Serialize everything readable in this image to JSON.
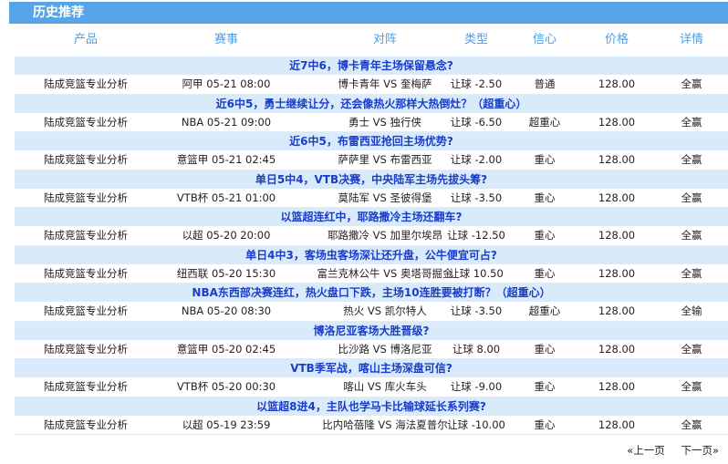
{
  "header": {
    "title": "历史推荐"
  },
  "columns": [
    "产品",
    "赛事",
    "对阵",
    "类型",
    "信心",
    "价格",
    "详情"
  ],
  "rows": [
    {
      "headline": "近7中6，博卡青年主场保留悬念?",
      "product": "陆成竞篮专业分析",
      "match": "阿甲 05-21 08:00",
      "teams": "博卡青年 VS 奎梅萨",
      "type": "让球 -2.50",
      "confidence": "普通",
      "price": "128.00",
      "result": "全赢"
    },
    {
      "headline": "近6中5，勇士继续让分，还会像热火那样大热倒灶？（超重心）",
      "product": "陆成竞篮专业分析",
      "match": "NBA 05-21 09:00",
      "teams": "勇士 VS 独行侠",
      "type": "让球 -6.50",
      "confidence": "超重心",
      "price": "128.00",
      "result": "全赢"
    },
    {
      "headline": "近6中5，布雷西亚抢回主场优势?",
      "product": "陆成竞篮专业分析",
      "match": "意篮甲 05-21 02:45",
      "teams": "萨萨里 VS 布雷西亚",
      "type": "让球 -2.00",
      "confidence": "重心",
      "price": "128.00",
      "result": "全赢"
    },
    {
      "headline": "单日5中4，VTB决赛，中央陆军主场先拔头筹?",
      "product": "陆成竞篮专业分析",
      "match": "VTB杯 05-21 01:00",
      "teams": "莫陆军 VS 圣彼得堡",
      "type": "让球 -3.50",
      "confidence": "重心",
      "price": "128.00",
      "result": "全赢"
    },
    {
      "headline": "以篮超连红中，耶路撒冷主场还翻车?",
      "product": "陆成竞篮专业分析",
      "match": "以超 05-20 20:00",
      "teams": "耶路撒冷 VS 加里尔埃昂",
      "type": "让球 -12.50",
      "confidence": "重心",
      "price": "128.00",
      "result": "全赢"
    },
    {
      "headline": "单日4中3，客场虫客场深让还升盘，公牛便宜可占?",
      "product": "陆成竞篮专业分析",
      "match": "纽西联 05-20 15:30",
      "teams": "富兰克林公牛 VS 奥塔哥掘金",
      "type": "让球 10.50",
      "confidence": "重心",
      "price": "128.00",
      "result": "全赢"
    },
    {
      "headline": "NBA东西部决赛连红，热火盘口下跌，主场10连胜要被打断？（超重心）",
      "product": "陆成竞篮专业分析",
      "match": "NBA 05-20 08:30",
      "teams": "热火 VS 凯尔特人",
      "type": "让球 -3.50",
      "confidence": "超重心",
      "price": "128.00",
      "result": "全输"
    },
    {
      "headline": "博洛尼亚客场大胜晋级?",
      "product": "陆成竞篮专业分析",
      "match": "意篮甲 05-20 02:45",
      "teams": "比沙路 VS 博洛尼亚",
      "type": "让球 8.00",
      "confidence": "重心",
      "price": "128.00",
      "result": "全赢"
    },
    {
      "headline": "VTB季军战，喀山主场深盘可信?",
      "product": "陆成竞篮专业分析",
      "match": "VTB杯 05-20 00:30",
      "teams": "喀山 VS 库火车头",
      "type": "让球 -9.00",
      "confidence": "重心",
      "price": "128.00",
      "result": "全赢"
    },
    {
      "headline": "以篮超8进4，主队也学马卡比输球延长系列赛?",
      "product": "陆成竞篮专业分析",
      "match": "以超 05-19 23:59",
      "teams": "比内哈蓓隆 VS 海法夏普尔",
      "type": "让球 -10.00",
      "confidence": "重心",
      "price": "128.00",
      "result": "全赢"
    }
  ],
  "pager": {
    "prev": "«上一页",
    "next": "下一页»"
  }
}
